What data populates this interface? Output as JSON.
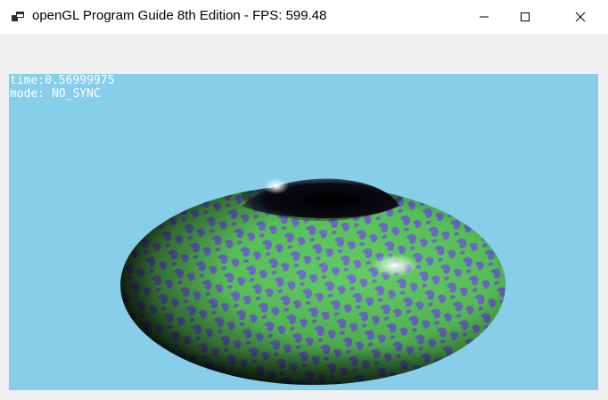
{
  "window": {
    "title": "openGL Program Guide 8th Edition - FPS: 599.48",
    "icon": "app-window-icon",
    "controls": {
      "minimize_icon": "minimize-icon",
      "maximize_icon": "maximize-icon",
      "close_icon": "close-icon"
    }
  },
  "viewport": {
    "background_color": "#87ceeb",
    "time_text": "time:0.56999975",
    "mode_text": "mode: NO_SYNC",
    "scene": "textured-torus",
    "pattern_colors": [
      "#5bc85b",
      "#6b6bc8"
    ]
  }
}
